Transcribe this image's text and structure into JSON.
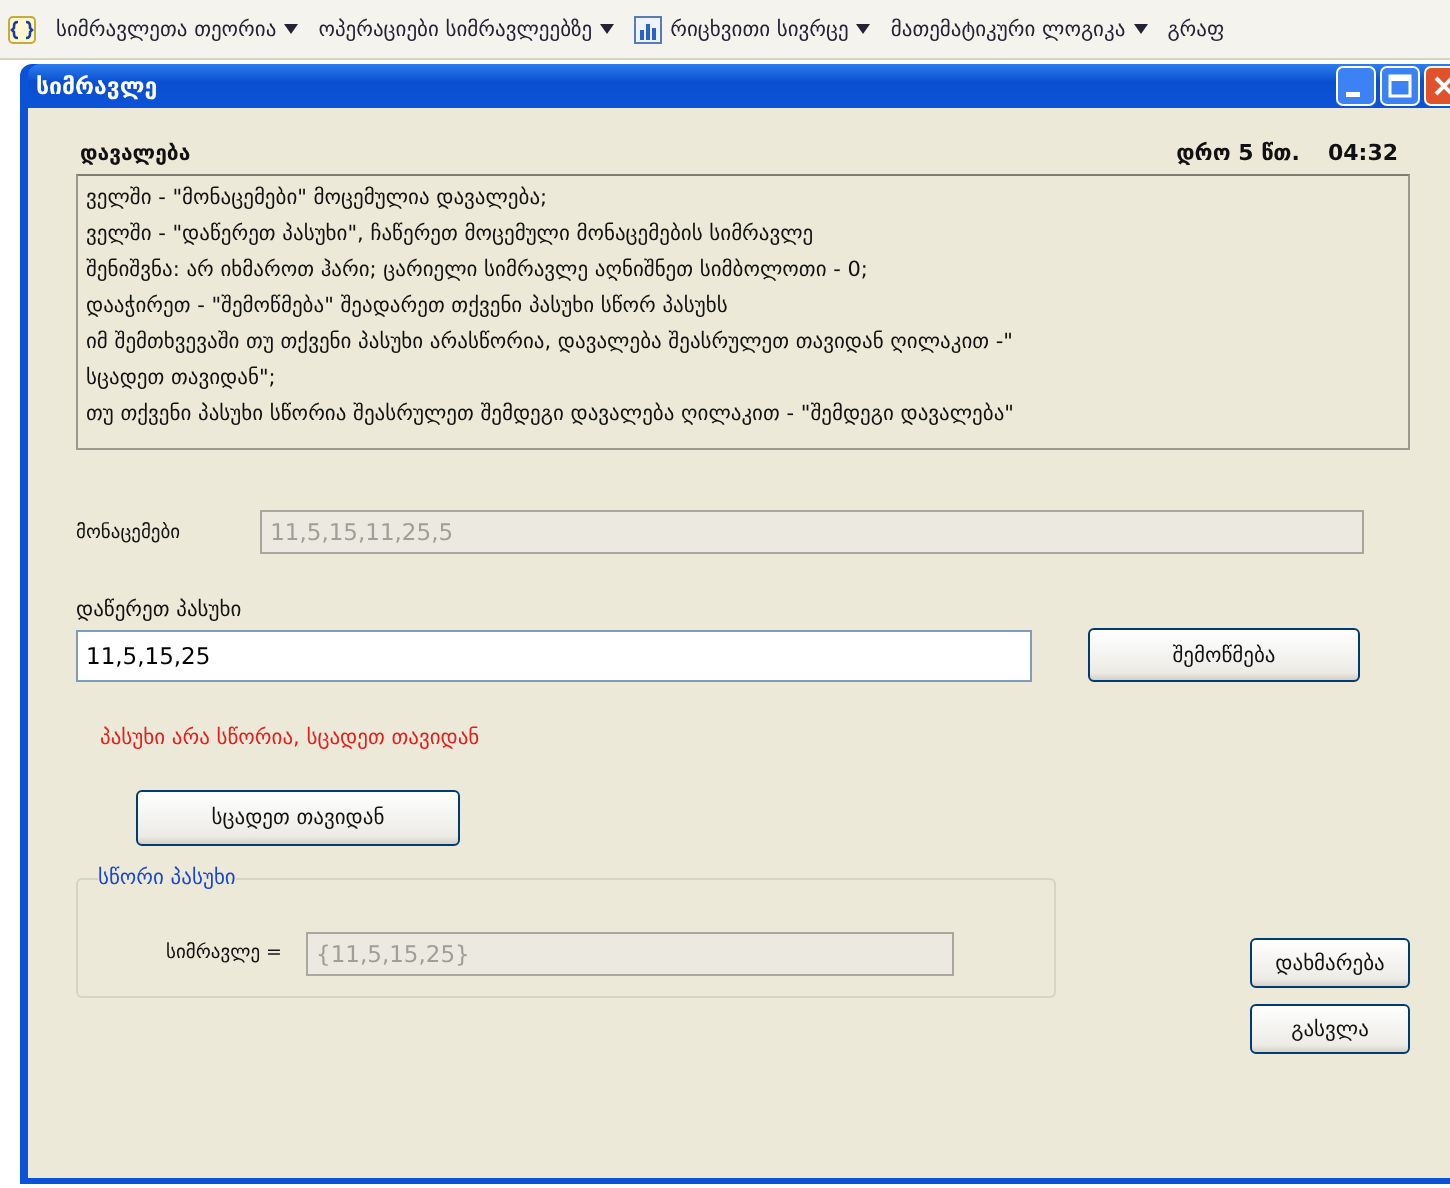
{
  "toolbar": {
    "items": [
      {
        "label": "სიმრავლეთა თეორია",
        "kind": "menu"
      },
      {
        "label": "ოპერაციები სიმრავლეებზე",
        "kind": "menu"
      },
      {
        "label": "რიცხვითი სივრცე",
        "kind": "chart-menu"
      },
      {
        "label": "მათემატიკური ლოგიკა",
        "kind": "menu"
      },
      {
        "label": "გრაფ",
        "kind": "cut"
      }
    ]
  },
  "window": {
    "title": "სიმრავლე"
  },
  "task": {
    "label": "დავალება",
    "time_label": "დრო 5 წთ.",
    "time": "04:32",
    "lines": [
      "ველში - \"მონაცემები\" მოცემულია დავალება;",
      "ველში - \"დაწერეთ პასუხი\", ჩაწერეთ მოცემული მონაცემების სიმრავლე",
      "შენიშვნა: არ იხმაროთ ჰარი; ცარიელი სიმრავლე აღნიშნეთ სიმბოლოთი - 0;",
      "დააჭირეთ  - \"შემოწმება\" შეადარეთ თქვენი პასუხი სწორ პასუხს",
      "იმ შემთხვევაში თუ თქვენი პასუხი არასწორია, დავალება შეასრულეთ თავიდან ღილაკით -\"",
      "სცადეთ თავიდან\";",
      "თუ თქვენი პასუხი სწორია შეასრულეთ შემდეგი დავალება ღილაკით - \"შემდეგი დავალება\""
    ]
  },
  "data_field": {
    "label": "მონაცემები",
    "value": "11,5,15,11,25,5",
    "disabled": true
  },
  "answer_field": {
    "label": "დაწერეთ პასუხი",
    "value": "11,5,15,25",
    "disabled": false
  },
  "check_button": {
    "label": "შემოწმება"
  },
  "result_message": "პასუხი არა სწორია, სცადეთ თავიდან",
  "retry_button": {
    "label": "სცადეთ თავიდან"
  },
  "correct_answer": {
    "title": "სწორი პასუხი",
    "label": "სიმრავლე =",
    "value": "{11,5,15,25}",
    "disabled": true
  },
  "buttons": [
    {
      "label": "დახმარება"
    },
    {
      "label": "გასვლა"
    }
  ]
}
